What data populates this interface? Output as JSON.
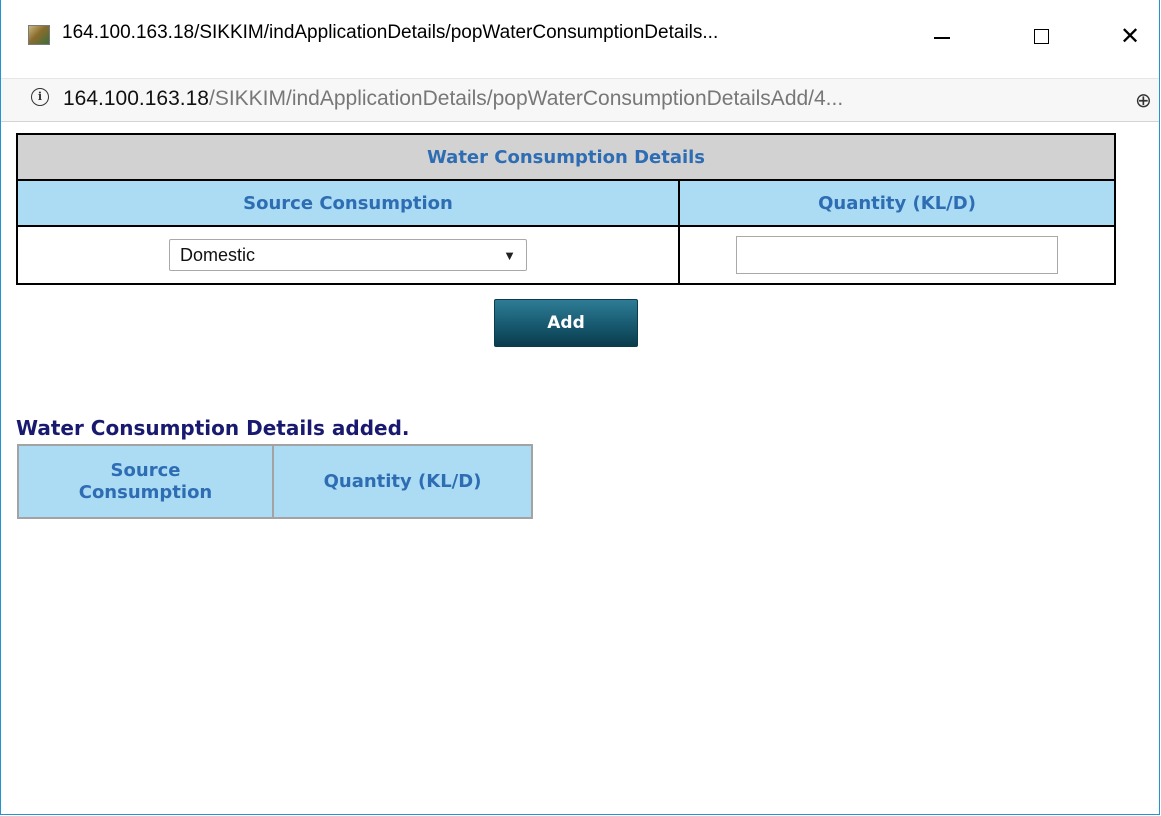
{
  "window": {
    "title": "164.100.163.18/SIKKIM/indApplicationDetails/popWaterConsumptionDetails...",
    "controls": {
      "minimize": "minimize-icon",
      "maximize": "maximize-icon",
      "close": "✕"
    }
  },
  "address_bar": {
    "host": "164.100.163.18",
    "path": "/SIKKIM/indApplicationDetails/popWaterConsumptionDetailsAdd/4...",
    "info_icon": "i",
    "zoom_icon": "⊕"
  },
  "form": {
    "title": "Water Consumption Details",
    "col_source": "Source Consumption",
    "col_quantity": "Quantity (KL/D)",
    "source_selected": "Domestic",
    "quantity_value": "",
    "add_label": "Add"
  },
  "added": {
    "label": "Water Consumption Details added.",
    "col_source_line1": "Source",
    "col_source_line2": "Consumption",
    "col_quantity": "Quantity (KL/D)"
  },
  "colors": {
    "header_text": "#2e6db3",
    "header_blue_bg": "#abdcf3",
    "header_gray_bg": "#d2d2d2",
    "added_label": "#191970",
    "button_bg": "#17596f",
    "window_border": "#1f96d3"
  }
}
